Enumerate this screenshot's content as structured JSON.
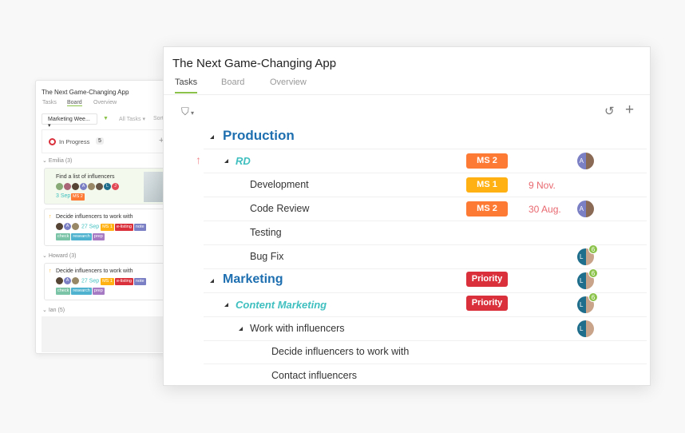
{
  "back": {
    "title": "The Next Game-Changing App",
    "tabs": [
      "Tasks",
      "Board",
      "Overview"
    ],
    "filter": "Marketing Wee...",
    "all_tasks": "All Tasks",
    "sort": "Sort",
    "column": "In Progress",
    "column_count": "5",
    "groups": [
      {
        "label": "Emilia (3)"
      },
      {
        "label": "Howard (3)"
      },
      {
        "label": "Ian (5)"
      }
    ],
    "cards": [
      {
        "title": "Find a list of influencers",
        "date": "3 Sep",
        "tags": [
          "MS 2"
        ]
      },
      {
        "title": "Decide influencers to work with",
        "date": "27 Sep",
        "tags": [
          "MS 1",
          "e-listing",
          "note"
        ],
        "labels": [
          "check",
          "research",
          "prep"
        ]
      },
      {
        "title": "Decide influencers to work with",
        "date": "27 Sep",
        "tags": [
          "MS 1",
          "e-listing",
          "note"
        ],
        "labels": [
          "check",
          "research",
          "prep"
        ]
      }
    ]
  },
  "main": {
    "title": "The Next Game-Changing App",
    "tabs": [
      "Tasks",
      "Board",
      "Overview"
    ],
    "active_tab": "Tasks",
    "rows": [
      {
        "label": "Production",
        "level": "section"
      },
      {
        "label": "RD",
        "level": "sub",
        "tag": "MS 2",
        "avatar": "A"
      },
      {
        "label": "Development",
        "tag": "MS 1",
        "date": "9 Nov."
      },
      {
        "label": "Code Review",
        "tag": "MS 2",
        "date": "30 Aug.",
        "avatar": "A"
      },
      {
        "label": "Testing"
      },
      {
        "label": "Bug Fix",
        "avatar": "L",
        "badge": "6"
      },
      {
        "label": "Marketing",
        "level": "section",
        "tag": "Priority",
        "avatar": "L",
        "badge": "6"
      },
      {
        "label": "Content Marketing",
        "level": "sub",
        "tag": "Priority",
        "avatar": "L",
        "badge": "6"
      },
      {
        "label": "Work with influencers",
        "avatar": "L"
      },
      {
        "label": "Decide influencers to work with"
      },
      {
        "label": "Contact influencers"
      }
    ]
  },
  "colors": {
    "ms1": "#ffb012",
    "ms2": "#fd7a35",
    "priority": "#d9303b",
    "section": "#1e6fb0",
    "sub": "#3fbfbf",
    "accent": "#8bc34a",
    "date": "#e8686f"
  }
}
